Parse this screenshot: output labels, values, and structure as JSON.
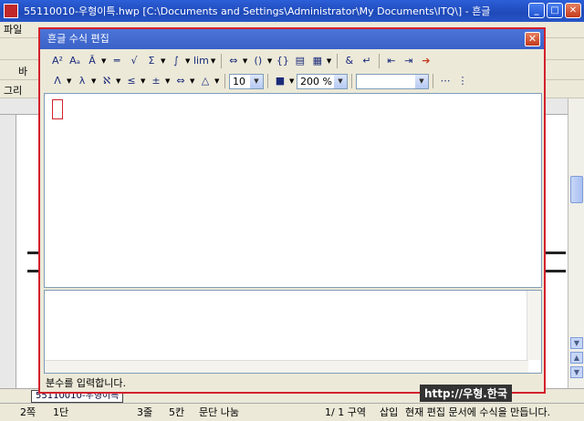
{
  "window": {
    "title": "55110010-우형이특.hwp [C:\\Documents and Settings\\Administrator\\My Documents\\ITQ\\] - 흔글"
  },
  "menu": {
    "first": "파일"
  },
  "bg_labels": {
    "row1": "바",
    "row2": "그리"
  },
  "dialog": {
    "title": "흔글 수식 편집",
    "font_size": "10",
    "zoom": "200 %",
    "style_value": "",
    "status_text": "분수를 입력합니다."
  },
  "toolbar1": [
    "A²",
    "Aₐ",
    "Ā",
    "═",
    "√",
    "Σ",
    "∫",
    "lim",
    "⇔",
    "()",
    "{}",
    "▤",
    "▦",
    "&",
    "↵",
    "⇤",
    "⇥",
    "➔"
  ],
  "toolbar2": [
    "Λ",
    "λ",
    "ℵ",
    "≤",
    "±",
    "⇔",
    "△"
  ],
  "doc": {
    "tab_label": "55110010-우형이특"
  },
  "status": {
    "page": "2쪽",
    "col": "1단",
    "line": "3줄",
    "char": "5칸",
    "split": "문단 나눔",
    "pos": "1/ 1 구역",
    "mode": "삽입",
    "msg": "현재 편집 문서에 수식을 만듭니다."
  },
  "watermark": "http://우형.한국",
  "colors": {
    "highlight": "#d4202c",
    "titlebar": "#1f49b8"
  }
}
